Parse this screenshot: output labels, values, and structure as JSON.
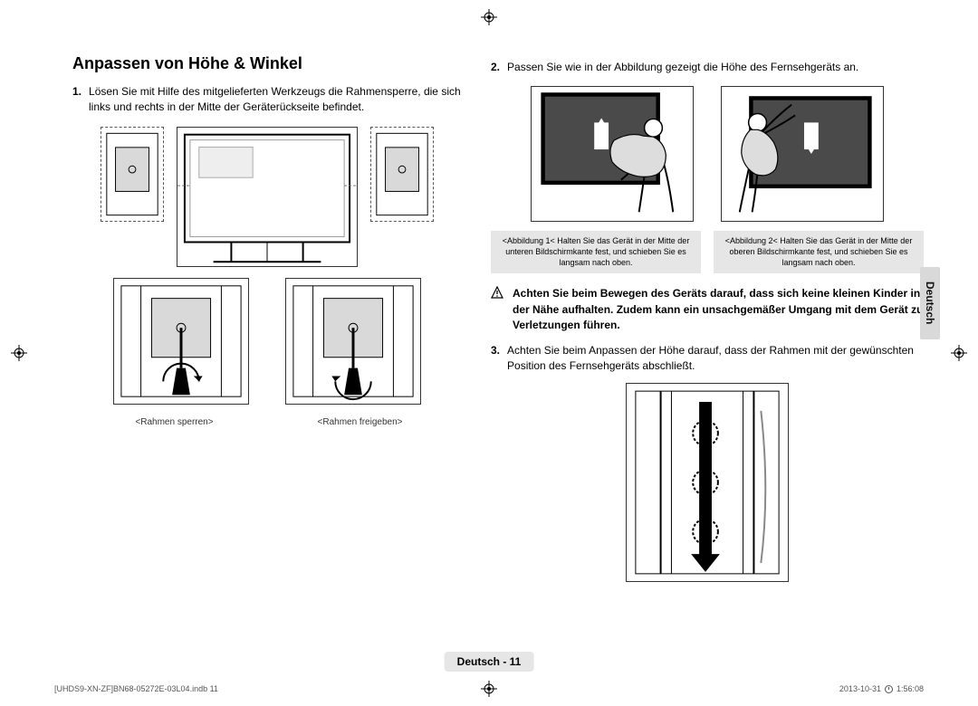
{
  "title": "Anpassen von Höhe & Winkel",
  "side_tab": "Deutsch",
  "left": {
    "step1_num": "1.",
    "step1_text": "Lösen Sie mit Hilfe des mitgelieferten Werkzeugs die Rahmensperre, die sich links und rechts in der Mitte der Geräterückseite befindet.",
    "caption_lock": "<Rahmen sperren>",
    "caption_unlock": "<Rahmen freigeben>"
  },
  "right": {
    "step2_num": "2.",
    "step2_text": "Passen Sie wie in der Abbildung gezeigt die Höhe des Fernsehgeräts an.",
    "fig1_caption": "<Abbildung 1< Halten Sie das Gerät in der Mitte der unteren Bildschirmkante fest, und schieben Sie es langsam nach oben.",
    "fig2_caption": "<Abbildung 2< Halten Sie das Gerät in der Mitte der oberen Bildschirmkante fest, und schieben Sie es langsam nach oben.",
    "warning_text": "Achten Sie beim Bewegen des Geräts darauf, dass sich keine kleinen Kinder in der Nähe aufhalten. Zudem kann ein unsachgemäßer Umgang mit dem Gerät zu Verletzungen führen.",
    "step3_num": "3.",
    "step3_text": "Achten Sie beim Anpassen der Höhe darauf, dass der Rahmen mit der gewünschten Position des Fernsehgeräts abschließt."
  },
  "page_badge": "Deutsch - 11",
  "footer_left": "[UHDS9-XN-ZF]BN68-05272E-03L04.indb   11",
  "footer_date": "2013-10-31",
  "footer_time": "1:56:08"
}
